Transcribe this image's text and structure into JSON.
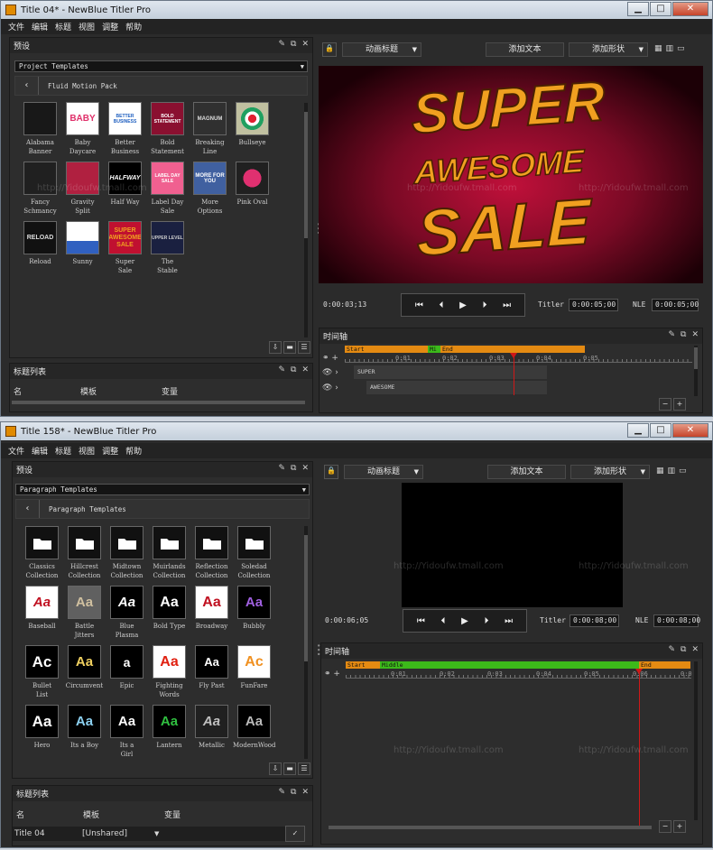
{
  "top": {
    "window_title": "Title 04* - NewBlue Titler Pro",
    "menu": [
      "文件",
      "编辑",
      "标题",
      "视图",
      "调整",
      "帮助"
    ],
    "presets_title": "预设",
    "template_dropdown": "Project Templates",
    "nav_label": "Fluid Motion Pack",
    "templates": [
      {
        "label": "Alabama\nBanner",
        "icon": "alabama-thumb"
      },
      {
        "label": "Baby\nDaycare",
        "icon": "baby-thumb",
        "text": "BABY"
      },
      {
        "label": "Better\nBusiness",
        "icon": "business-thumb",
        "text": "BETTER BUSINESS"
      },
      {
        "label": "Bold\nStatement",
        "icon": "bold-thumb",
        "text": "BOLD STATEMENT"
      },
      {
        "label": "Breaking\nLine",
        "icon": "breaking-thumb",
        "text": "MAGNUM"
      },
      {
        "label": "Bullseye",
        "icon": "bullseye-thumb"
      },
      {
        "label": "Fancy\nSchmancy",
        "icon": "fancy-thumb"
      },
      {
        "label": "Gravity\nSplit",
        "icon": "gravity-thumb"
      },
      {
        "label": "Half Way",
        "icon": "halfway-thumb",
        "text": "HALFWAY"
      },
      {
        "label": "Label Day\nSale",
        "icon": "labelday-thumb",
        "text": "LABEL DAY SALE"
      },
      {
        "label": "More\nOptions",
        "icon": "more-thumb",
        "text": "MORE FOR YOU"
      },
      {
        "label": "Pink Oval",
        "icon": "pinkoval-thumb"
      },
      {
        "label": "Reload",
        "icon": "reload-thumb",
        "text": "RELOAD"
      },
      {
        "label": "Sunny",
        "icon": "sunny-thumb"
      },
      {
        "label": "Super\nSale",
        "icon": "supersale-thumb",
        "text": "SUPER AWESOME SALE"
      },
      {
        "label": "The\nStable",
        "icon": "stable-thumb",
        "text": "UPPER LEVEL"
      }
    ],
    "title_list_header": "标题列表",
    "title_list_columns": [
      "名",
      "模板",
      "变量"
    ],
    "toolbar": {
      "animate": "动画标题",
      "add_text": "添加文本",
      "add_shape": "添加形状"
    },
    "preview_text": [
      "SUPER",
      "AWESOME",
      "SALE"
    ],
    "current_time": "0:00:03;13",
    "titler_label": "Titler",
    "titler_duration": "0:00:05;00",
    "nle_label": "NLE",
    "nle_duration": "0:00:05;00",
    "timeline_title": "时间轴",
    "segments": [
      "Start",
      "Mi",
      "End"
    ],
    "ruler_ticks": [
      "0:01",
      "0:02",
      "0:03",
      "0:04",
      "0:05"
    ],
    "tracks": [
      "SUPER",
      "AWESOME"
    ],
    "watermark": "http://Yidoufw.tmall.com"
  },
  "bottom": {
    "window_title": "Title 158* - NewBlue Titler Pro",
    "menu": [
      "文件",
      "编辑",
      "标题",
      "视图",
      "调整",
      "帮助"
    ],
    "presets_title": "预设",
    "template_dropdown": "Paragraph Templates",
    "nav_label": "Paragraph Templates",
    "templates": [
      {
        "label": "Classics\nCollection",
        "icon": "folder-icon"
      },
      {
        "label": "Hillcrest\nCollection",
        "icon": "folder-icon"
      },
      {
        "label": "Midtown\nCollection",
        "icon": "folder-icon"
      },
      {
        "label": "Muirlands\nCollection",
        "icon": "folder-icon"
      },
      {
        "label": "Reflection\nCollection",
        "icon": "folder-icon"
      },
      {
        "label": "Soledad\nCollection",
        "icon": "folder-icon"
      },
      {
        "label": "Baseball",
        "icon": "baseball-thumb",
        "text": "Aa"
      },
      {
        "label": "Battle\nJitters",
        "icon": "battle-thumb",
        "text": "Aa"
      },
      {
        "label": "Blue\nPlasma",
        "icon": "plasma-thumb",
        "text": "Aa"
      },
      {
        "label": "Bold Type",
        "icon": "boldtype-thumb",
        "text": "Aa"
      },
      {
        "label": "Broadway",
        "icon": "broadway-thumb",
        "text": "Aa"
      },
      {
        "label": "Bubbly",
        "icon": "bubbly-thumb",
        "text": "Aa"
      },
      {
        "label": "Bullet\nList",
        "icon": "bullet-thumb",
        "text": "Ac"
      },
      {
        "label": "Circumvent",
        "icon": "circumvent-thumb",
        "text": "Aa"
      },
      {
        "label": "Epic",
        "icon": "epic-thumb",
        "text": "a"
      },
      {
        "label": "Fighting\nWords",
        "icon": "fighting-thumb",
        "text": "Aa"
      },
      {
        "label": "Fly Past",
        "icon": "flypast-thumb",
        "text": "Aa"
      },
      {
        "label": "FunFare",
        "icon": "funfare-thumb",
        "text": "Ac"
      },
      {
        "label": "Hero",
        "icon": "hero-thumb",
        "text": "Aa"
      },
      {
        "label": "Its a Boy",
        "icon": "boy-thumb",
        "text": "Aa"
      },
      {
        "label": "Its a\nGirl",
        "icon": "girl-thumb",
        "text": "Aa"
      },
      {
        "label": "Lantern",
        "icon": "lantern-thumb",
        "text": "Aa"
      },
      {
        "label": "Metallic",
        "icon": "metallic-thumb",
        "text": "Aa"
      },
      {
        "label": "ModernWood",
        "icon": "wood-thumb",
        "text": "Aa"
      }
    ],
    "title_list_header": "标题列表",
    "title_list_columns": [
      "名",
      "模板",
      "变量"
    ],
    "title_row": {
      "name": "Title 04",
      "template": "[Unshared]"
    },
    "toolbar": {
      "animate": "动画标题",
      "add_text": "添加文本",
      "add_shape": "添加形状"
    },
    "current_time": "0:00:06;05",
    "titler_label": "Titler",
    "titler_duration": "0:00:08;00",
    "nle_label": "NLE",
    "nle_duration": "0:00:08;00",
    "timeline_title": "时间轴",
    "segments": [
      "Start",
      "Middle",
      "End"
    ],
    "ruler_ticks": [
      "0:01",
      "0:02",
      "0:03",
      "0:04",
      "0:05",
      "0:06",
      "0:0"
    ],
    "watermark": "http://Yidoufw.tmall.com"
  },
  "colors": {
    "start_seg": "#e48a12",
    "middle_seg": "#3cba1a",
    "playhead": "#d01818",
    "preview_red": "#c0103a",
    "text_orange": "#f0a020"
  }
}
